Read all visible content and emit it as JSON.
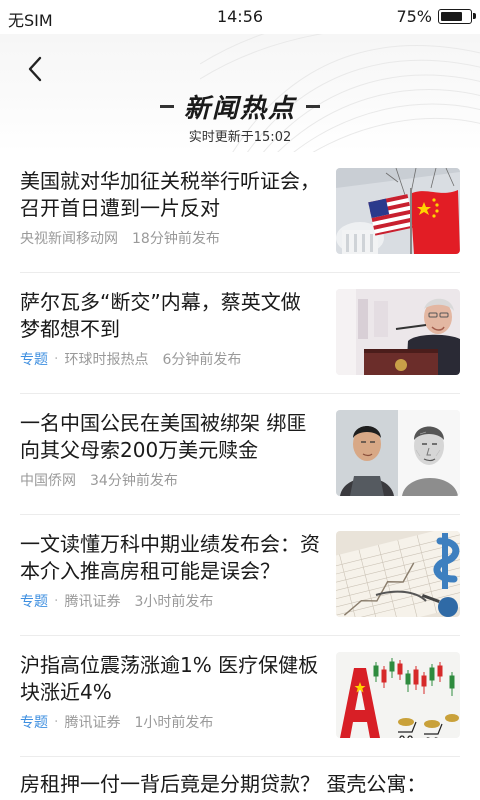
{
  "status_bar": {
    "carrier": "无SIM",
    "time": "14:56",
    "battery_percent": "75%",
    "battery_level": 0.75
  },
  "header": {
    "title": "新闻热点",
    "subtitle": "实时更新于15:02",
    "back_icon": "chevron-left-icon"
  },
  "news": [
    {
      "headline": "美国就对华加征关税举行听证会，召开首日遭到一片反对",
      "tag": "",
      "source": "央视新闻移动网",
      "time": "18分钟前发布",
      "thumb": "us-china-flags-capitol"
    },
    {
      "headline": "萨尔瓦多“断交”内幕，蔡英文做梦都想不到",
      "tag": "专题",
      "source": "环球时报热点",
      "time": "6分钟前发布",
      "thumb": "speaker-at-podium"
    },
    {
      "headline": "一名中国公民在美国被绑架 绑匪向其父母索200万美元赎金",
      "tag": "",
      "source": "中国侨网",
      "time": "34分钟前发布",
      "thumb": "photo-and-sketch-portrait"
    },
    {
      "headline": "一文读懂万科中期业绩发布会：资本介入推高房租可能是误会？",
      "tag": "专题",
      "source": "腾讯证券",
      "time": "3小时前发布",
      "thumb": "finance-chart-dollar"
    },
    {
      "headline": "沪指高位震荡涨逾1% 医疗保健板块涨近4%",
      "tag": "专题",
      "source": "腾讯证券",
      "time": "1小时前发布",
      "thumb": "stock-candlestick-letter-a"
    },
    {
      "headline": "房租押一付一背后竟是分期贷款？ 蛋壳公寓：",
      "tag": "",
      "source": "",
      "time": "",
      "thumb": ""
    }
  ]
}
